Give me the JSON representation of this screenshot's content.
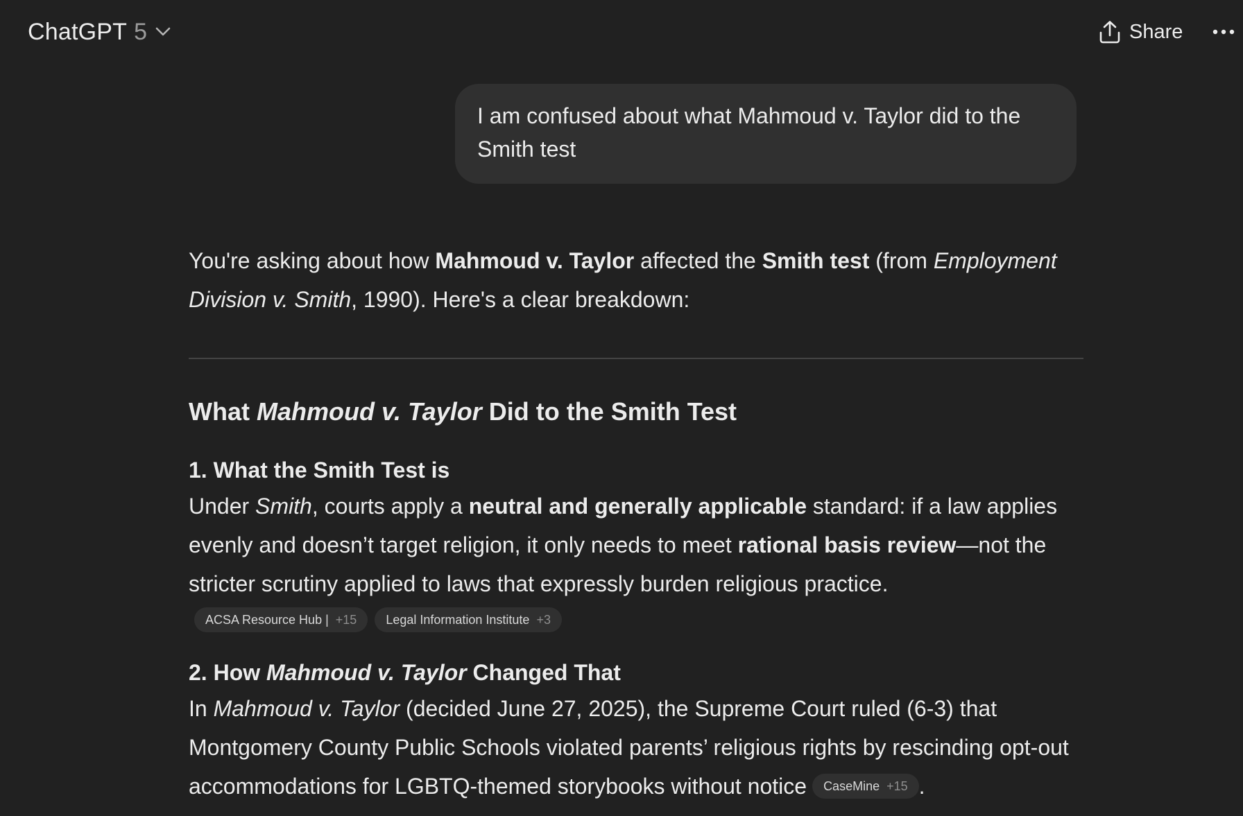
{
  "header": {
    "model_name": "ChatGPT",
    "model_version": "5",
    "share_label": "Share",
    "icons": {
      "model_chevron": "chevron-down-icon",
      "share": "share-upload-icon",
      "more": "more-horizontal-icon"
    }
  },
  "user_message": {
    "text": "I am confused about what Mahmoud v. Taylor did to the Smith test"
  },
  "assistant": {
    "intro": {
      "t1": "You're asking about how ",
      "b1": "Mahmoud v. Taylor",
      "t2": " affected the ",
      "b2": "Smith test",
      "t3": " (from ",
      "i1": "Employment Division v. Smith",
      "t4": ", 1990). Here's a clear breakdown:"
    },
    "heading": {
      "t1": "What ",
      "i1": "Mahmoud v. Taylor",
      "t2": " Did to the Smith Test"
    },
    "section1": {
      "title": "1. What the Smith Test is",
      "p_t1": "Under ",
      "p_i1": "Smith",
      "p_t2": ", courts apply a ",
      "p_b1": "neutral and generally applicable",
      "p_t3": " standard: if a law applies evenly and doesn’t target religion, it only needs to meet ",
      "p_b2": "rational basis review",
      "p_t4": "—not the stricter scrutiny applied to laws that expressly burden religious practice.",
      "chips": [
        {
          "label": "ACSA Resource Hub |",
          "count": "+15"
        },
        {
          "label": "Legal Information Institute",
          "count": "+3"
        }
      ]
    },
    "section2": {
      "title_t1": "2. How ",
      "title_i1": "Mahmoud v. Taylor",
      "title_t2": " Changed That",
      "p_t1": "In ",
      "p_i1": "Mahmoud v. Taylor",
      "p_t2": " (decided June 27, 2025), the Supreme Court ruled (6-3) that Montgomery County Public Schools violated parents’ religious rights by rescinding opt-out accommodations for LGBTQ-themed storybooks without notice",
      "chip": {
        "label": "CaseMine",
        "count": "+15"
      },
      "p_t3": "."
    }
  },
  "colors": {
    "background": "#212121",
    "bubble": "#303030",
    "text": "#ececec",
    "muted": "#9b9b9b",
    "divider": "#444444"
  }
}
